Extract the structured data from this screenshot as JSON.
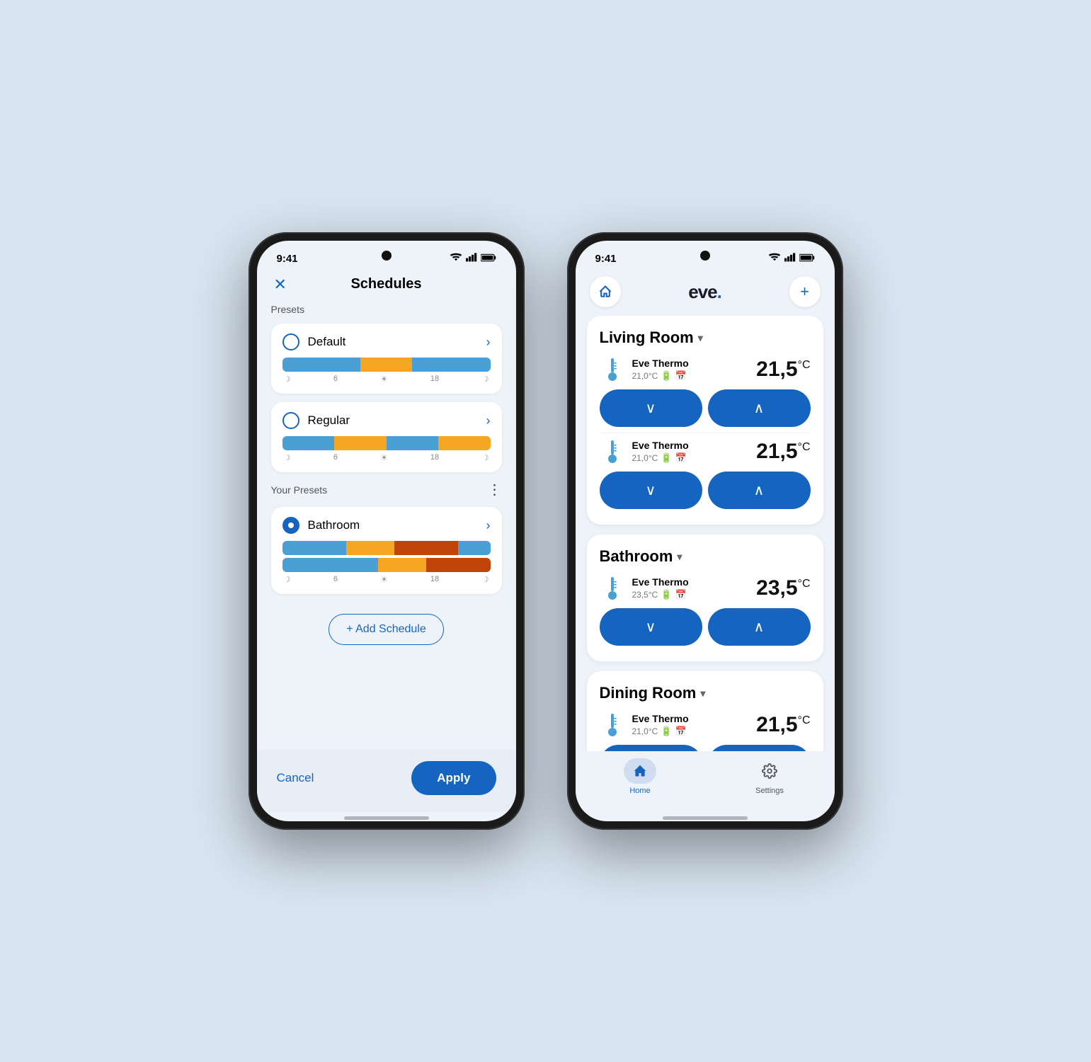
{
  "phone1": {
    "statusBar": {
      "time": "9:41",
      "wifiIcon": "▲",
      "signalIcon": "▲"
    },
    "header": {
      "title": "Schedules",
      "closeLabel": "✕"
    },
    "presetsLabel": "Presets",
    "presets": [
      {
        "name": "Default",
        "selected": false,
        "bars": [
          {
            "color": "#4a9fd4",
            "flex": 3
          },
          {
            "color": "#f5a623",
            "flex": 2
          },
          {
            "color": "#4a9fd4",
            "flex": 3
          }
        ]
      },
      {
        "name": "Regular",
        "selected": false,
        "bars": [
          {
            "color": "#4a9fd4",
            "flex": 2
          },
          {
            "color": "#f5a623",
            "flex": 2
          },
          {
            "color": "#4a9fd4",
            "flex": 2
          },
          {
            "color": "#f5a623",
            "flex": 2
          }
        ]
      }
    ],
    "yourPresetsLabel": "Your Presets",
    "yourPresets": [
      {
        "name": "Bathroom",
        "selected": true,
        "bars": [
          {
            "color": "#4a9fd4",
            "flex": 2
          },
          {
            "color": "#f5a623",
            "flex": 1
          },
          {
            "color": "#c0430a",
            "flex": 2
          },
          {
            "color": "#4a9fd4",
            "flex": 1
          },
          {
            "color": "#f5a623",
            "flex": 1
          },
          {
            "color": "#c0430a",
            "flex": 1
          }
        ]
      }
    ],
    "addScheduleLabel": "+ Add Schedule",
    "footer": {
      "cancelLabel": "Cancel",
      "applyLabel": "Apply"
    },
    "scheduleTimeLabels": [
      "☽",
      "6",
      "☀",
      "18",
      "☽"
    ]
  },
  "phone2": {
    "statusBar": {
      "time": "9:41"
    },
    "header": {
      "logoText": "eve",
      "logoDot": ".",
      "addIcon": "+"
    },
    "homeIcon": "⌂",
    "rooms": [
      {
        "name": "Living Room",
        "devices": [
          {
            "deviceName": "Eve Thermo",
            "subTemp": "21,0°C",
            "temp": "21,5",
            "unit": "°C"
          },
          {
            "deviceName": "Eve Thermo",
            "subTemp": "21,0°C",
            "temp": "21,5",
            "unit": "°C"
          }
        ]
      },
      {
        "name": "Bathroom",
        "devices": [
          {
            "deviceName": "Eve Thermo",
            "subTemp": "23,5°C",
            "temp": "23,5",
            "unit": "°C"
          }
        ]
      },
      {
        "name": "Dining Room",
        "devices": [
          {
            "deviceName": "Eve Thermo",
            "subTemp": "21,0°C",
            "temp": "21,5",
            "unit": "°C"
          }
        ]
      }
    ],
    "bottomNav": {
      "homeLabel": "Home",
      "settingsLabel": "Settings"
    },
    "decreaseIcon": "∨",
    "increaseIcon": "∧"
  }
}
